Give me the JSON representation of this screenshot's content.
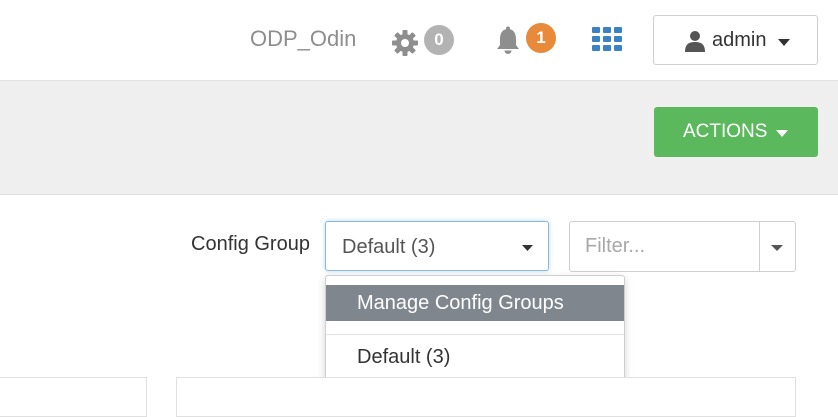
{
  "header": {
    "cluster_name": "ODP_Odin",
    "ops_count": "0",
    "alerts_count": "1",
    "user_label": "admin"
  },
  "toolbar": {
    "actions_label": "ACTIONS"
  },
  "config": {
    "group_label": "Config Group",
    "selected_group": "Default (3)",
    "filter_placeholder": "Filter...",
    "menu": {
      "items": [
        "Manage Config Groups",
        "Default (3)"
      ]
    }
  },
  "colors": {
    "actions_green": "#5cb85c",
    "alerts_badge": "#e98a3b",
    "ops_badge": "#b3b3b3",
    "views_icon": "#3b82c4",
    "menu_highlight": "#7f868e"
  },
  "icons": [
    "gear-icon",
    "bell-icon",
    "grid-icon",
    "user-icon",
    "caret-down-icon"
  ]
}
